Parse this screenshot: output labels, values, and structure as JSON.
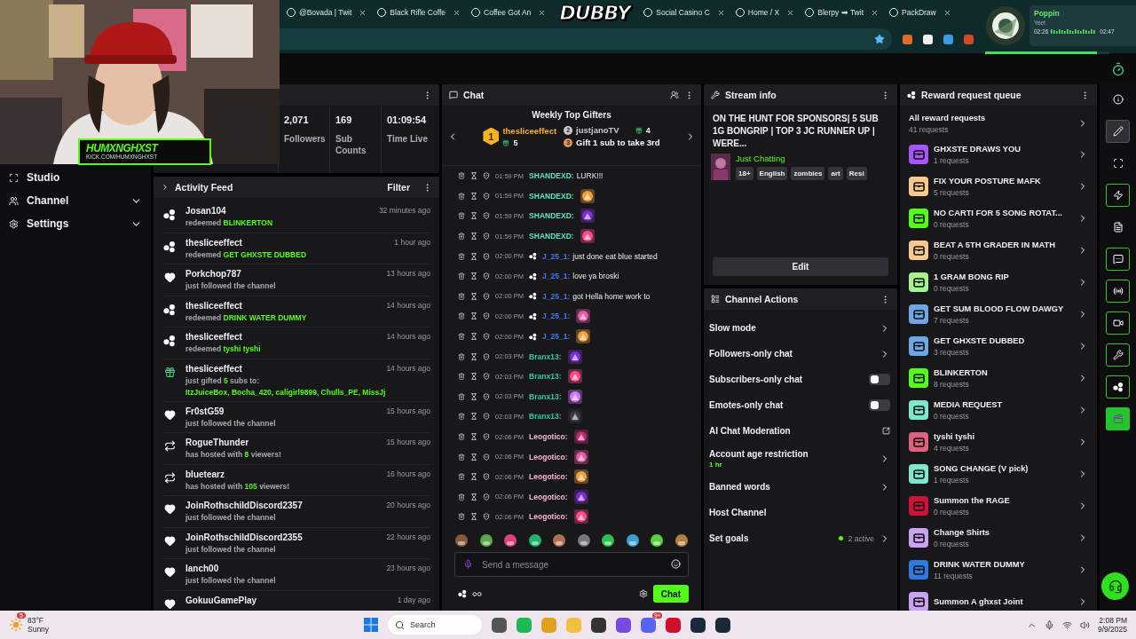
{
  "browser": {
    "tabs_left": [
      {
        "title": "@Bovada | Twit"
      },
      {
        "title": "Black Rifle Coffe"
      },
      {
        "title": "Coffee Got An"
      }
    ],
    "logo": "DUBBY",
    "tabs_right": [
      {
        "title": "Social Casino C"
      },
      {
        "title": "Home / X"
      },
      {
        "title": "Blerpy ➡ Twit"
      },
      {
        "title": "PackDraw"
      }
    ]
  },
  "music": {
    "title": "Poppin",
    "artist": "Yeet",
    "elapsed": "02:26",
    "duration": "02:47",
    "level": 0.9
  },
  "overlay_logo": {
    "name": "HUMXNGHXST",
    "url": "KICK.COM/HUMXNGHXST"
  },
  "sidebar": {
    "items": [
      {
        "label": "Studio",
        "kind": "studio",
        "expandable": false
      },
      {
        "label": "Channel",
        "kind": "channel",
        "expandable": true
      },
      {
        "label": "Settings",
        "kind": "settings",
        "expandable": true
      }
    ]
  },
  "stats": [
    {
      "value": "2,071",
      "label": "Followers"
    },
    {
      "value": "169",
      "label": "Sub Counts"
    },
    {
      "value": "01:09:54",
      "label": "Time Live"
    }
  ],
  "activity_feed": {
    "title": "Activity Feed",
    "filter": "Filter",
    "items": [
      {
        "kind": "redeem",
        "user": "Josan104",
        "time": "32 minutes ago",
        "detail": "redeemed **BLINKERTON**"
      },
      {
        "kind": "redeem",
        "user": "thesliceeffect",
        "time": "1 hour ago",
        "detail": "redeemed **GET GHXSTE DUBBED**"
      },
      {
        "kind": "follow",
        "user": "Porkchop787",
        "time": "13 hours ago",
        "detail": "just followed the channel"
      },
      {
        "kind": "redeem",
        "user": "thesliceeffect",
        "time": "14 hours ago",
        "detail": "redeemed **DRINK WATER DUMMY**"
      },
      {
        "kind": "redeem",
        "user": "thesliceeffect",
        "time": "14 hours ago",
        "detail": "redeemed **tyshi tyshi**"
      },
      {
        "kind": "gift",
        "user": "thesliceeffect",
        "time": "14 hours ago",
        "detail": "just gifted **5** subs to:",
        "recipients": "ItzJuiceBox, Bocha_420, caligirl9899, Chulls_PE, MissJj"
      },
      {
        "kind": "follow",
        "user": "Fr0stG59",
        "time": "15 hours ago",
        "detail": "just followed the channel"
      },
      {
        "kind": "host",
        "user": "RogueThunder",
        "time": "15 hours ago",
        "detail": "has hosted with **8** viewers!"
      },
      {
        "kind": "host",
        "user": "bluetearz",
        "time": "16 hours ago",
        "detail": "has hosted with **105** viewers!"
      },
      {
        "kind": "follow",
        "user": "JoinRothschildDiscord2357",
        "time": "20 hours ago",
        "detail": "just followed the channel"
      },
      {
        "kind": "follow",
        "user": "JoinRothschildDiscord2355",
        "time": "22 hours ago",
        "detail": "just followed the channel"
      },
      {
        "kind": "follow",
        "user": "lanch00",
        "time": "23 hours ago",
        "detail": "just followed the channel"
      },
      {
        "kind": "follow",
        "user": "GokuuGamePlay",
        "time": "1 day ago"
      }
    ]
  },
  "chat": {
    "title": "Chat",
    "gifters_title": "Weekly Top Gifters",
    "gifters": [
      {
        "rank": "1",
        "name": "thesliceeffect",
        "count": "5"
      },
      {
        "rank": "2",
        "name": "justjanoTV",
        "count": "4"
      },
      {
        "rank": "3",
        "name": "Gift 1 sub to take 3rd"
      }
    ],
    "messages": [
      {
        "kind": "text",
        "time": "01:59 PM",
        "user": "SHANDEXD:",
        "color": "#5ee6b8",
        "badge": false,
        "text": "LURK!!!"
      },
      {
        "kind": "emote",
        "time": "01:59 PM",
        "user": "SHANDEXD:",
        "color": "#5ee6b8",
        "badge": false
      },
      {
        "kind": "emote",
        "time": "01:59 PM",
        "user": "SHANDEXD:",
        "color": "#5ee6b8",
        "badge": false
      },
      {
        "kind": "emote",
        "time": "01:59 PM",
        "user": "SHANDEXD:",
        "color": "#5ee6b8",
        "badge": false
      },
      {
        "kind": "text",
        "time": "02:00 PM",
        "user": "J_25_1:",
        "color": "#3f7cf0",
        "badge": true,
        "text": "just done eat blue started"
      },
      {
        "kind": "text",
        "time": "02:00 PM",
        "user": "J_25_1:",
        "color": "#3f7cf0",
        "badge": true,
        "text": "love ya broski"
      },
      {
        "kind": "text",
        "time": "02:00 PM",
        "user": "J_25_1:",
        "color": "#3f7cf0",
        "badge": true,
        "text": "got Hella home work to"
      },
      {
        "kind": "emote",
        "time": "02:00 PM",
        "user": "J_25_1:",
        "color": "#3f7cf0",
        "badge": true
      },
      {
        "kind": "emote",
        "time": "02:00 PM",
        "user": "J_25_1:",
        "color": "#3f7cf0",
        "badge": true
      },
      {
        "kind": "emote",
        "time": "02:03 PM",
        "user": "Branx13:",
        "color": "#2ecc98",
        "badge": false
      },
      {
        "kind": "emote",
        "time": "02:03 PM",
        "user": "Branx13:",
        "color": "#2ecc98",
        "badge": false
      },
      {
        "kind": "emote",
        "time": "02:03 PM",
        "user": "Branx13:",
        "color": "#2ecc98",
        "badge": false
      },
      {
        "kind": "emote",
        "time": "02:03 PM",
        "user": "Branx13:",
        "color": "#2ecc98",
        "badge": false
      },
      {
        "kind": "emote",
        "time": "02:06 PM",
        "user": "Leogotico:",
        "color": "#f5b8d2",
        "badge": false
      },
      {
        "kind": "emote",
        "time": "02:06 PM",
        "user": "Leogotico:",
        "color": "#f5b8d2",
        "badge": false
      },
      {
        "kind": "emote",
        "time": "02:06 PM",
        "user": "Leogotico:",
        "color": "#f5b8d2",
        "badge": false
      },
      {
        "kind": "emote",
        "time": "02:06 PM",
        "user": "Leogotico:",
        "color": "#f5b8d2",
        "badge": false
      },
      {
        "kind": "emote",
        "time": "02:06 PM",
        "user": "Leogotico:",
        "color": "#f5b8d2",
        "badge": false
      }
    ],
    "input": {
      "placeholder": "Send a message"
    },
    "send": "Chat"
  },
  "stream_info": {
    "title": "Stream info",
    "stream_title": "ON THE HUNT FOR SPONSORS| 5 SUB 1G BONGRIP | TOP 3 JC RUNNER UP | WERE...",
    "category": "Just Chatting",
    "tags": [
      "18+",
      "English",
      "zombies",
      "art",
      "Resi"
    ],
    "edit": "Edit"
  },
  "channel_actions": {
    "title": "Channel Actions",
    "items": [
      {
        "label": "Slow mode",
        "kind": "chevron"
      },
      {
        "label": "Followers-only chat",
        "kind": "chevron"
      },
      {
        "label": "Subscribers-only chat",
        "kind": "toggle",
        "on": false
      },
      {
        "label": "Emotes-only chat",
        "kind": "toggle",
        "on": false
      },
      {
        "label": "AI Chat Moderation",
        "kind": "external"
      },
      {
        "label": "Account age restriction",
        "kind": "chevron",
        "sub": "1 hr"
      },
      {
        "label": "Banned words",
        "kind": "chevron"
      },
      {
        "label": "Host Channel",
        "kind": "plain"
      },
      {
        "label": "Set goals",
        "kind": "chevron",
        "status": "2 active"
      }
    ]
  },
  "rewards": {
    "title": "Reward request queue",
    "all": {
      "label": "All reward requests",
      "count": "41 requests"
    },
    "items": [
      {
        "name": "GHXSTE DRAWS YOU",
        "count": "1 requests",
        "color": "#a855f7"
      },
      {
        "name": "FIX YOUR POSTURE MAFK",
        "count": "5 requests",
        "color": "#f8c88c"
      },
      {
        "name": "NO CARTI FOR 5 SONG ROTAT...",
        "count": "0 requests",
        "color": "#53fc18"
      },
      {
        "name": "BEAT A 5TH GRADER IN MATH",
        "count": "0 requests",
        "color": "#f8c88c"
      },
      {
        "name": "1 GRAM BONG RIP",
        "count": "0 requests",
        "color": "#a6f28f"
      },
      {
        "name": "GET SUM BLOOD FLOW DAWGY",
        "count": "7 requests",
        "color": "#6fa6e6"
      },
      {
        "name": "GET GHXSTE DUBBED",
        "count": "3 requests",
        "color": "#6fa6e6"
      },
      {
        "name": "BLINKERTON",
        "count": "8 requests",
        "color": "#53fc18"
      },
      {
        "name": "MEDIA REQUEST",
        "count": "0 requests",
        "color": "#7ee8cf"
      },
      {
        "name": "tyshi tyshi",
        "count": "4 requests",
        "color": "#e0607e"
      },
      {
        "name": "SONG CHANGE (V pick)",
        "count": "1 requests",
        "color": "#7ee8cf"
      },
      {
        "name": "Summon the RAGE",
        "count": "0 requests",
        "color": "#d0103a"
      },
      {
        "name": "Change Shirts",
        "count": "0 requests",
        "color": "#c9a2f2"
      },
      {
        "name": "DRINK WATER DUMMY",
        "count": "11 requests",
        "color": "#2d7be0"
      },
      {
        "name": "Summon A ghxst Joint",
        "color": "#c9a2f2"
      }
    ]
  },
  "rail": {
    "items": [
      {
        "kind": "info",
        "selected": false,
        "highlighted": false
      },
      {
        "kind": "edit",
        "selected": true,
        "highlighted": false
      },
      {
        "kind": "capture",
        "selected": false,
        "highlighted": false
      },
      {
        "kind": "bolt",
        "selected": false,
        "highlighted": true
      },
      {
        "kind": "notes",
        "selected": false,
        "highlighted": false
      },
      {
        "kind": "chat",
        "selected": false,
        "highlighted": true
      },
      {
        "kind": "broadcast",
        "selected": false,
        "highlighted": true
      },
      {
        "kind": "camera",
        "selected": false,
        "highlighted": true
      },
      {
        "kind": "wrench",
        "selected": false,
        "highlighted": true
      },
      {
        "kind": "points",
        "selected": false,
        "highlighted": true
      },
      {
        "kind": "clapper",
        "selected": false,
        "highlighted": false
      }
    ]
  },
  "taskbar": {
    "temperature": "83°F",
    "weather": "Sunny",
    "weather_badge": "5",
    "search": "Search",
    "chat_badge": "9+",
    "time": "2:08 PM",
    "date": "9/9/2025"
  }
}
